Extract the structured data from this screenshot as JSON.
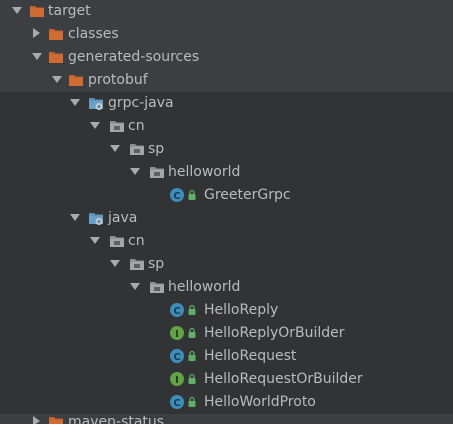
{
  "tree": {
    "target": {
      "label": "target"
    },
    "classes": {
      "label": "classes"
    },
    "generated_sources": {
      "label": "generated-sources"
    },
    "protobuf": {
      "label": "protobuf"
    },
    "grpc_java": {
      "label": "grpc-java",
      "cn": {
        "label": "cn"
      },
      "sp": {
        "label": "sp"
      },
      "helloworld": {
        "label": "helloworld"
      },
      "files": [
        {
          "label": "GreeterGrpc",
          "kind": "class"
        }
      ]
    },
    "java": {
      "label": "java",
      "cn": {
        "label": "cn"
      },
      "sp": {
        "label": "sp"
      },
      "helloworld": {
        "label": "helloworld"
      },
      "files": [
        {
          "label": "HelloReply",
          "kind": "class"
        },
        {
          "label": "HelloReplyOrBuilder",
          "kind": "interface"
        },
        {
          "label": "HelloRequest",
          "kind": "class"
        },
        {
          "label": "HelloRequestOrBuilder",
          "kind": "interface"
        },
        {
          "label": "HelloWorldProto",
          "kind": "class"
        }
      ]
    },
    "maven_status": {
      "label": "maven-status"
    }
  },
  "icons": {
    "orange_folder": "excluded-folder-icon",
    "gray_folder": "package-folder-icon",
    "source_root": "generated-source-root-icon",
    "class": "class-icon",
    "interface": "interface-icon",
    "lock": "readonly-lock-icon"
  },
  "colors": {
    "background": "#3c3f41",
    "generated_band": "#313335",
    "text": "#b9bcbe",
    "orange_folder": "#c4612c",
    "gray_folder": "#9a9da0",
    "class_badge": "#3d8eb9",
    "interface_badge": "#62a346",
    "lock": "#63ad6b"
  }
}
